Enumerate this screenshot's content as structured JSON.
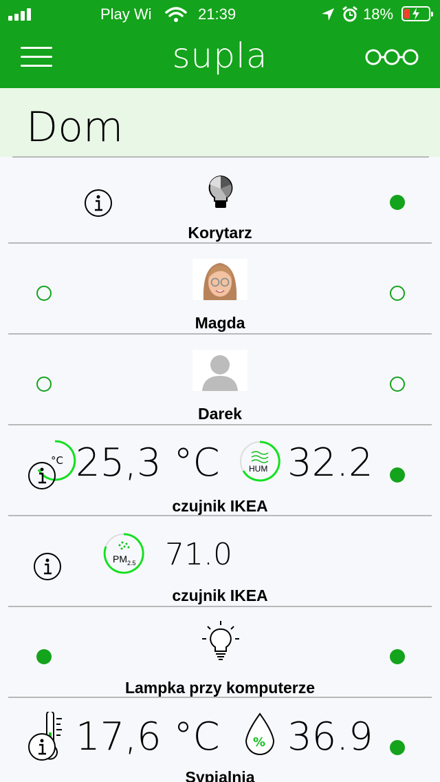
{
  "status_bar": {
    "carrier": "Play Wi",
    "time": "21:39",
    "battery": "18%",
    "icons": [
      "signal-icon",
      "wifi-icon",
      "location-icon",
      "alarm-icon",
      "battery-charging-icon"
    ]
  },
  "header": {
    "app_name": "supla",
    "menu_icon": "hamburger-icon",
    "more_icon": "three-rings-icon",
    "accent_color": "#14a31c"
  },
  "location": {
    "title": "Dom"
  },
  "channels": [
    {
      "caption": "Korytarz",
      "icon": "dimmer-bulb-icon",
      "left": "info-icon",
      "right_state": "on"
    },
    {
      "caption": "Magda",
      "icon": "memoji-avatar-icon",
      "left_state": "off",
      "right_state": "off"
    },
    {
      "caption": "Darek",
      "icon": "person-silhouette-icon",
      "left_state": "off",
      "right_state": "off"
    },
    {
      "caption": "czujnik IKEA",
      "icon": "temperature-humidity-icon",
      "temperature": "25,3 °C",
      "temp_unit_label": "°C",
      "humidity": "32.2",
      "humidity_label": "HUM",
      "right_state": "on"
    },
    {
      "caption": "czujnik IKEA",
      "icon": "pm25-icon",
      "pm_label": "PM",
      "pm_sub": "2.5",
      "value": "71.0"
    },
    {
      "caption": "Lampka przy komputerze",
      "icon": "light-bulb-icon",
      "left_state": "on",
      "right_state": "on"
    },
    {
      "caption": "Sypialnia",
      "icon": "thermometer-icon",
      "temperature": "17,6 °C",
      "humidity": "36.9",
      "humidity_label": "%",
      "right_state": "on"
    }
  ]
}
